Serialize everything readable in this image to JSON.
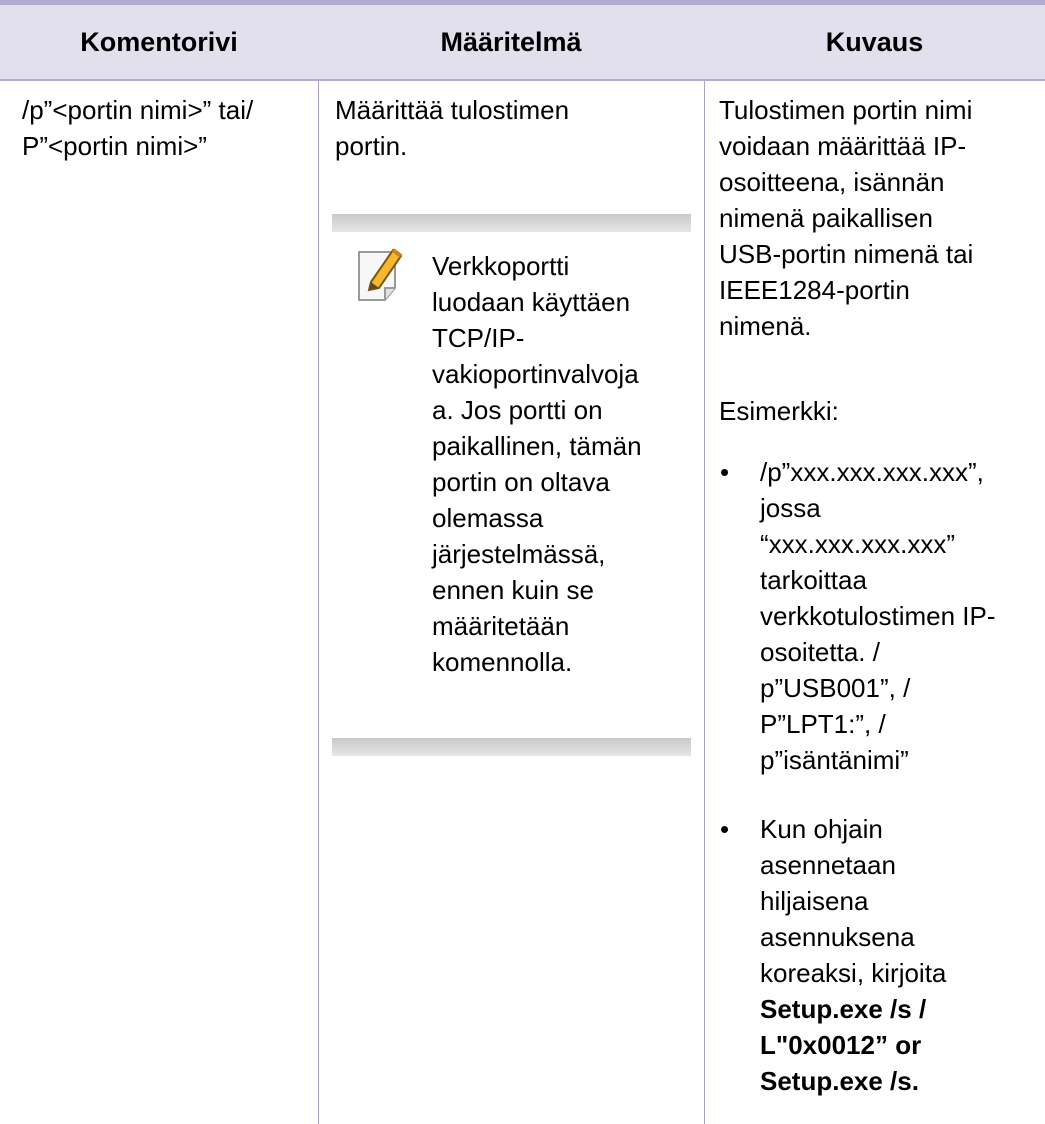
{
  "table": {
    "headers": [
      "Komentorivi",
      "Määritelmä",
      "Kuvaus"
    ],
    "row": {
      "command_lines": [
        "/p”<portin nimi>” tai/",
        "P”<portin nimi>”"
      ],
      "definition_lines": [
        "Määrittää tulostimen",
        "portin."
      ],
      "note": {
        "icon": "note-pencil-icon",
        "lines": [
          "Verkkoportti",
          "luodaan käyttäen",
          "TCP/IP-",
          "vakioportinvalvoja",
          "a. Jos portti on",
          "paikallinen, tämän",
          "portin on oltava",
          "olemassa",
          "järjestelmässä,",
          "ennen kuin se",
          "määritetään",
          "komennolla."
        ]
      },
      "description_lines": [
        "Tulostimen portin nimi",
        "voidaan määrittää IP-",
        "osoitteena, isännän",
        "nimenä paikallisen",
        "USB-portin nimenä tai",
        "IEEE1284-portin",
        "nimenä."
      ],
      "example_label": "Esimerkki:",
      "bullet_symbol": "•",
      "bullets": [
        {
          "lines": [
            "/p”xxx.xxx.xxx.xxx”,",
            "jossa",
            "“xxx.xxx.xxx.xxx”",
            "tarkoittaa",
            "verkkotulostimen IP-",
            "osoitetta. /",
            "p”USB001”, /",
            "P”LPT1:”, /",
            "p”isäntänimi”"
          ]
        },
        {
          "lines": [
            "Kun ohjain",
            "asennetaan",
            "hiljaisena",
            "asennuksena",
            "koreaksi, kirjoita"
          ],
          "bold_lines": [
            "Setup.exe /s /",
            "L\"0x0012” or",
            "Setup.exe /s."
          ]
        }
      ]
    }
  },
  "colors": {
    "header_bg": "#e3e0ee",
    "rule": "#b3acd1",
    "column_divider": "#a7a3c5",
    "note_bar": "#d4d4d4",
    "note_icon_accent": "#f2a71b"
  }
}
